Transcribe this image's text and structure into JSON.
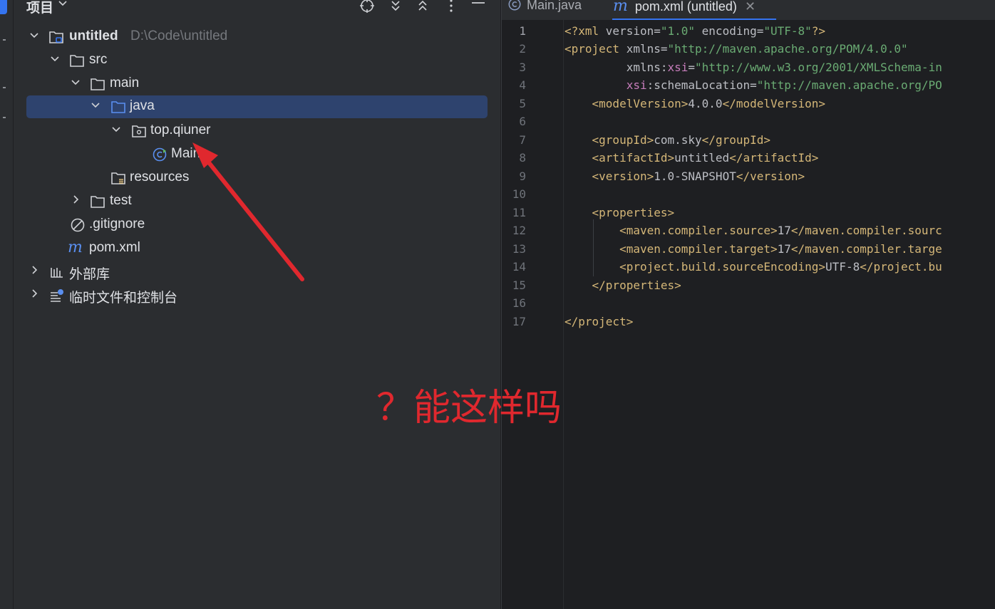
{
  "project_panel": {
    "title": "项目",
    "tree": [
      {
        "label": "untitled",
        "path": "D:\\Code\\untitled"
      },
      {
        "label": "src"
      },
      {
        "label": "main"
      },
      {
        "label": "java"
      },
      {
        "label": "top.qiuner"
      },
      {
        "label": "Main"
      },
      {
        "label": "resources"
      },
      {
        "label": "test"
      },
      {
        "label": ".gitignore"
      },
      {
        "label": "pom.xml"
      },
      {
        "label": "外部库"
      },
      {
        "label": "临时文件和控制台"
      }
    ]
  },
  "editor": {
    "tabs": [
      {
        "label": "Main.java",
        "icon": "java-class-icon"
      },
      {
        "label": "pom.xml (untitled)",
        "icon": "maven-icon"
      }
    ],
    "line_numbers": [
      "1",
      "2",
      "3",
      "4",
      "5",
      "6",
      "7",
      "8",
      "9",
      "10",
      "11",
      "12",
      "13",
      "14",
      "15",
      "16",
      "17"
    ]
  },
  "annotation": {
    "text": "？能这样吗",
    "color": "#e0282e"
  },
  "colors": {
    "selection": "#2e436e",
    "accent": "#3574f0",
    "xml_tag": "#d5b778",
    "xml_value": "#6aab73"
  }
}
